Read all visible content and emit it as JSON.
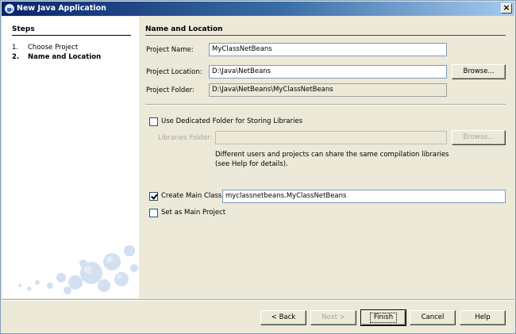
{
  "window": {
    "title": "New Java Application",
    "close_glyph": "×",
    "icon": "coffee-cup-icon"
  },
  "steps": {
    "header": "Steps",
    "items": [
      {
        "num": "1.",
        "label": "Choose Project",
        "current": false
      },
      {
        "num": "2.",
        "label": "Name and Location",
        "current": true
      }
    ]
  },
  "section": {
    "header": "Name and Location",
    "project_name_label": "Project Name:",
    "project_name_value": "MyClassNetBeans",
    "project_location_label": "Project Location:",
    "project_location_value": "D:\\Java\\NetBeans",
    "browse_label": "Browse...",
    "project_folder_label": "Project Folder:",
    "project_folder_value": "D:\\Java\\NetBeans\\MyClassNetBeans",
    "dedicated_folder_label": "Use Dedicated Folder for Storing Libraries",
    "dedicated_folder_checked": false,
    "libraries_folder_label": "Libraries Folder:",
    "libraries_folder_value": "",
    "libraries_browse_label": "Browse...",
    "libraries_desc_line1": "Different users and projects can share the same compilation libraries",
    "libraries_desc_line2": "(see Help for details).",
    "create_main_class_label": "Create Main Class",
    "create_main_class_checked": true,
    "main_class_value": "myclassnetbeans.MyClassNetBeans",
    "set_main_project_label": "Set as Main Project",
    "set_main_project_checked": false
  },
  "buttons": {
    "back": "< Back",
    "next": "Next >",
    "finish": "Finish",
    "cancel": "Cancel",
    "help": "Help"
  },
  "colors": {
    "title_bar_start": "#0a246a",
    "title_bar_end": "#a6caf0",
    "dialog_background": "#ece9d8",
    "steps_background": "#ffffff"
  }
}
